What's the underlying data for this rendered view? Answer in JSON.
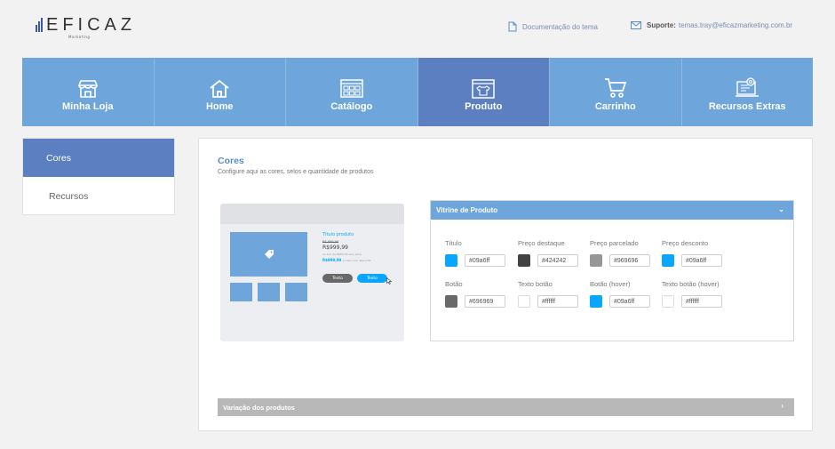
{
  "header": {
    "logo_text": "EFICAZ",
    "logo_sub": "Marketing",
    "doc_link": "Documentação do tema",
    "support_label": "Suporte:",
    "support_email": "temas.tray@eficazmarketing.com.br"
  },
  "nav": {
    "items": [
      {
        "label": "Minha Loja",
        "icon": "store-icon"
      },
      {
        "label": "Home",
        "icon": "home-icon"
      },
      {
        "label": "Catálogo",
        "icon": "catalog-icon"
      },
      {
        "label": "Produto",
        "icon": "product-icon",
        "active": true
      },
      {
        "label": "Carrinho",
        "icon": "cart-icon"
      },
      {
        "label": "Recursos Extras",
        "icon": "extras-icon"
      }
    ]
  },
  "sidebar": {
    "items": [
      {
        "label": "Cores",
        "active": true
      },
      {
        "label": "Recursos"
      }
    ]
  },
  "main": {
    "title": "Cores",
    "subtitle": "Configure aqui as cores, selos e quantidade de produtos",
    "preview": {
      "product_title": "Título produto",
      "old_price": "R$ 999,99",
      "price": "R$999,99",
      "installments": "ou 12x de R$83,33 sem juros",
      "discount_price": "R$999,99",
      "discount_note": "à vista com desconto",
      "button_1": "Texto",
      "button_2": "Texto"
    },
    "vitrine": {
      "title": "Vitrine de Produto",
      "fields": [
        {
          "label": "Título",
          "value": "#09a6ff",
          "color": "#09a6ff"
        },
        {
          "label": "Preço destaque",
          "value": "#424242",
          "color": "#424242"
        },
        {
          "label": "Preço parcelado",
          "value": "#969696",
          "color": "#969696"
        },
        {
          "label": "Preço desconto",
          "value": "#09a6ff",
          "color": "#09a6ff"
        },
        {
          "label": "Botão",
          "value": "#696969",
          "color": "#696969"
        },
        {
          "label": "Texto botão",
          "value": "#ffffff",
          "color": "#ffffff"
        },
        {
          "label": "Botão (hover)",
          "value": "#09a6ff",
          "color": "#09a6ff"
        },
        {
          "label": "Texto botão (hover)",
          "value": "#ffffff",
          "color": "#ffffff"
        }
      ]
    },
    "variacao": {
      "title": "Variação dos produtos"
    }
  },
  "colors": {
    "nav_bg": "#6ea6dc",
    "nav_active": "#5b7fc1",
    "title_blue": "#5a8ccc",
    "variacao_bg": "#b8b8b8"
  }
}
